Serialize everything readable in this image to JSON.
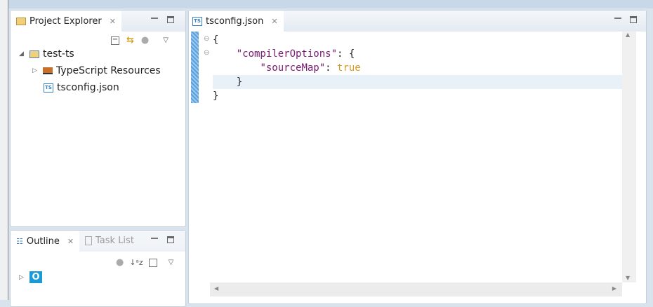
{
  "project_explorer": {
    "title": "Project Explorer",
    "tree": [
      {
        "label": "test-ts"
      },
      {
        "label": "TypeScript Resources"
      },
      {
        "label": "tsconfig.json"
      }
    ]
  },
  "outline": {
    "title": "Outline",
    "task_list": "Task List",
    "item_icon_text": "O"
  },
  "editor": {
    "tab_label": "tsconfig.json",
    "lines": [
      {
        "parts": [
          {
            "t": "{",
            "c": ""
          }
        ]
      },
      {
        "parts": [
          {
            "t": "    ",
            "c": ""
          },
          {
            "t": "\"compilerOptions\"",
            "c": "key"
          },
          {
            "t": ": {",
            "c": ""
          }
        ]
      },
      {
        "parts": [
          {
            "t": "        ",
            "c": ""
          },
          {
            "t": "\"sourceMap\"",
            "c": "key"
          },
          {
            "t": ": ",
            "c": ""
          },
          {
            "t": "true",
            "c": "kw"
          }
        ]
      },
      {
        "parts": [
          {
            "t": "    }",
            "c": ""
          }
        ]
      },
      {
        "parts": [
          {
            "t": "}",
            "c": ""
          }
        ]
      }
    ]
  },
  "colors": {
    "key": "#7a1a72",
    "keyword": "#d89b20",
    "ruler": "#5aa0dc"
  }
}
